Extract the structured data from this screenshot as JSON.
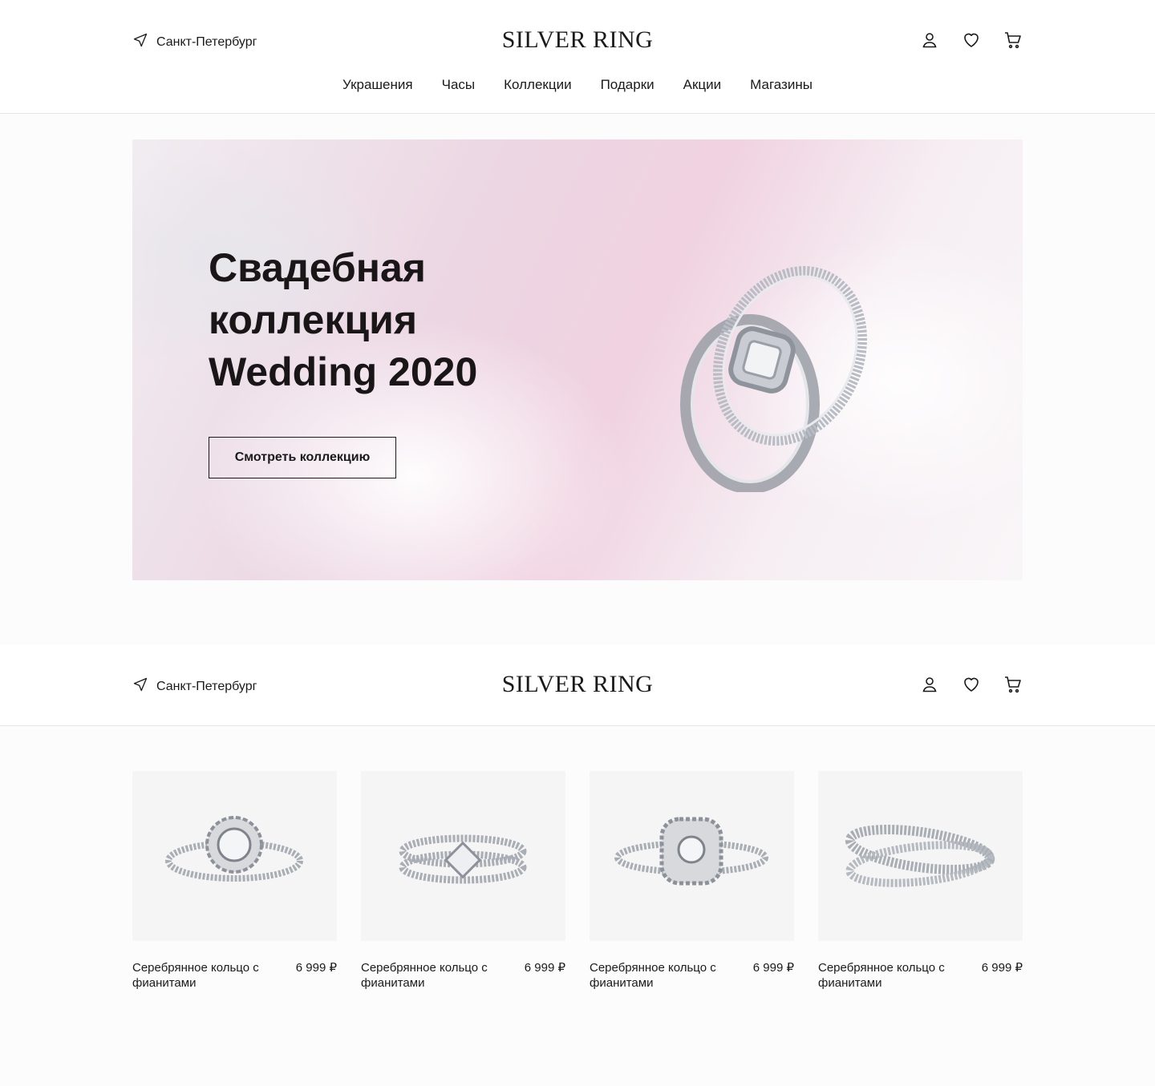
{
  "header": {
    "city": "Санкт-Петербург",
    "logo": "SILVER RING",
    "nav": [
      "Украшения",
      "Часы",
      "Коллекции",
      "Подарки",
      "Акции",
      "Магазины"
    ]
  },
  "hero": {
    "title_lines": [
      "Свадебная",
      "коллекция",
      "Wedding 2020"
    ],
    "button": "Смотреть коллекцию"
  },
  "header2": {
    "city": "Санкт-Петербург",
    "logo": "SILVER RING"
  },
  "products": [
    {
      "name": "Серебрянное кольцо с фианитами",
      "price": "6 999 ₽"
    },
    {
      "name": "Серебрянное кольцо с фианитами",
      "price": "6 999 ₽"
    },
    {
      "name": "Серебрянное кольцо с фианитами",
      "price": "6 999 ₽"
    },
    {
      "name": "Серебрянное кольцо с фианитами",
      "price": "6 999 ₽"
    }
  ],
  "icons": {
    "location": "location-arrow-icon",
    "account": "user-icon",
    "favorites": "heart-icon",
    "cart": "cart-icon"
  },
  "colors": {
    "text": "#1a1a1a",
    "hero_pink": "#f0d2e0"
  }
}
